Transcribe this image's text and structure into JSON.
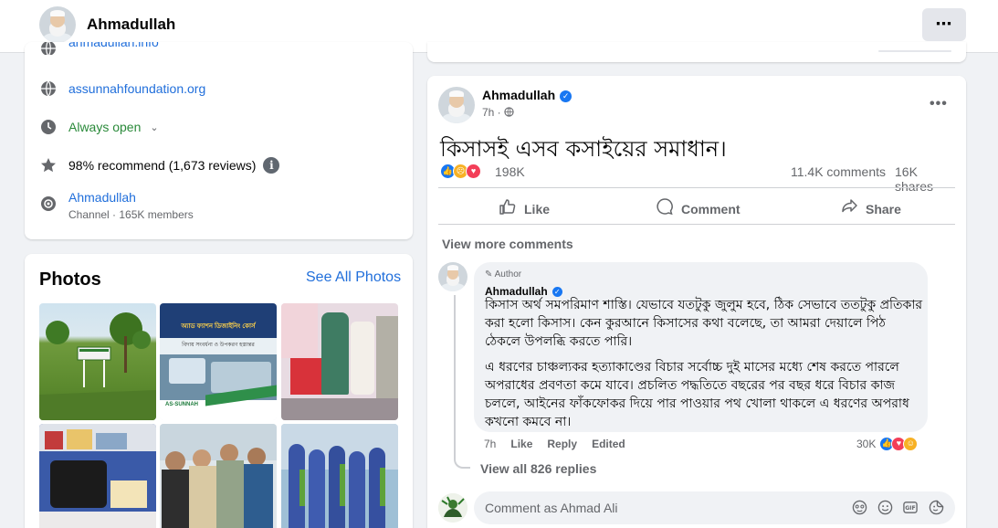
{
  "header": {
    "name": "Ahmadullah",
    "more_label": "⋯"
  },
  "intro": {
    "website_top": "ahmadullah.info",
    "website": "assunnahfoundation.org",
    "hours": "Always open",
    "rating": "98% recommend (1,673 reviews)",
    "channel_name": "Ahmadullah",
    "channel_sub": "Channel · 165K members"
  },
  "photos": {
    "title": "Photos",
    "see_all": "See All Photos",
    "banner_line1": "অ্যাড ফ্যাশন ডিজাইনিং কোর্স",
    "banner_line2": "বিদায় সংবর্ধনা ও উপকরণ হস্তান্তর",
    "banner_org": "AS-SUNNAH"
  },
  "post": {
    "author": "Ahmadullah",
    "time": "7h ·",
    "text": "কিসাসই এসব কসাইয়ের সমাধান।",
    "reactions": "198K",
    "comments": "11.4K comments",
    "shares": "16K shares",
    "like": "Like",
    "comment": "Comment",
    "share": "Share",
    "view_more": "View more comments"
  },
  "comment": {
    "tag": "Author",
    "name": "Ahmadullah",
    "para1": "কিসাস অর্থ সমপরিমাণ শাস্তি। যেভাবে যতটুকু জুলুম হবে, ঠিক সেভাবে ততটুকু প্রতিকার করা হলো কিসাস। কেন কুরআনে কিসাসের কথা বলেছে, তা আমরা দেয়ালে পিঠ ঠেকলে উপলব্ধি করতে পারি।",
    "para2": "এ ধরণের চাঞ্চল্যকর হত্যাকাণ্ডের বিচার সর্বোচ্চ দুই মাসের মধ্যে শেষ করতে পারলে অপরাধের প্রবণতা কমে যাবে। প্রচলিত পদ্ধতিতে বছরের পর বছর ধরে বিচার কাজ চললে, আইনের ফাঁকফোকর দিয়ে পার পাওয়ার পথ খোলা থাকলে এ ধরণের অপরাধ কখনো কমবে না।",
    "time": "7h",
    "like": "Like",
    "reply": "Reply",
    "edited": "Edited",
    "reactions": "30K",
    "view_replies": "View all 826 replies",
    "input_placeholder": "Comment as Ahmad Ali"
  },
  "colors": {
    "like_blue": "#1877f2",
    "love_red": "#f33e58",
    "sad_yellow": "#f7b125",
    "link_blue": "#216fdb",
    "open_green": "#2a8a3a"
  }
}
